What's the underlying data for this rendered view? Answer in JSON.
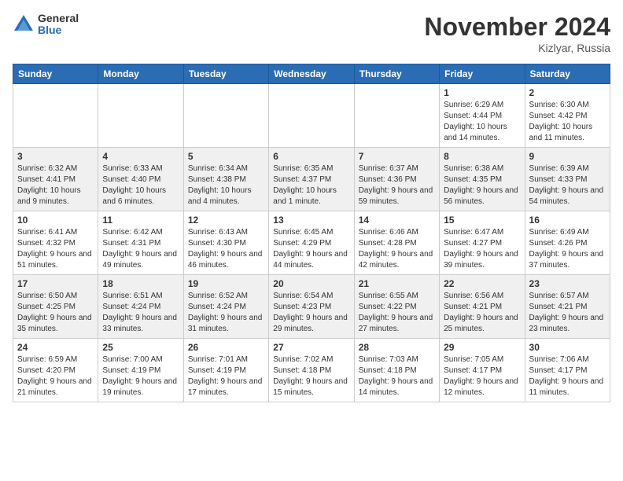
{
  "logo": {
    "general": "General",
    "blue": "Blue"
  },
  "title": "November 2024",
  "location": "Kizlyar, Russia",
  "days_of_week": [
    "Sunday",
    "Monday",
    "Tuesday",
    "Wednesday",
    "Thursday",
    "Friday",
    "Saturday"
  ],
  "weeks": [
    [
      {
        "day": "",
        "info": ""
      },
      {
        "day": "",
        "info": ""
      },
      {
        "day": "",
        "info": ""
      },
      {
        "day": "",
        "info": ""
      },
      {
        "day": "",
        "info": ""
      },
      {
        "day": "1",
        "info": "Sunrise: 6:29 AM\nSunset: 4:44 PM\nDaylight: 10 hours and 14 minutes."
      },
      {
        "day": "2",
        "info": "Sunrise: 6:30 AM\nSunset: 4:42 PM\nDaylight: 10 hours and 11 minutes."
      }
    ],
    [
      {
        "day": "3",
        "info": "Sunrise: 6:32 AM\nSunset: 4:41 PM\nDaylight: 10 hours and 9 minutes."
      },
      {
        "day": "4",
        "info": "Sunrise: 6:33 AM\nSunset: 4:40 PM\nDaylight: 10 hours and 6 minutes."
      },
      {
        "day": "5",
        "info": "Sunrise: 6:34 AM\nSunset: 4:38 PM\nDaylight: 10 hours and 4 minutes."
      },
      {
        "day": "6",
        "info": "Sunrise: 6:35 AM\nSunset: 4:37 PM\nDaylight: 10 hours and 1 minute."
      },
      {
        "day": "7",
        "info": "Sunrise: 6:37 AM\nSunset: 4:36 PM\nDaylight: 9 hours and 59 minutes."
      },
      {
        "day": "8",
        "info": "Sunrise: 6:38 AM\nSunset: 4:35 PM\nDaylight: 9 hours and 56 minutes."
      },
      {
        "day": "9",
        "info": "Sunrise: 6:39 AM\nSunset: 4:33 PM\nDaylight: 9 hours and 54 minutes."
      }
    ],
    [
      {
        "day": "10",
        "info": "Sunrise: 6:41 AM\nSunset: 4:32 PM\nDaylight: 9 hours and 51 minutes."
      },
      {
        "day": "11",
        "info": "Sunrise: 6:42 AM\nSunset: 4:31 PM\nDaylight: 9 hours and 49 minutes."
      },
      {
        "day": "12",
        "info": "Sunrise: 6:43 AM\nSunset: 4:30 PM\nDaylight: 9 hours and 46 minutes."
      },
      {
        "day": "13",
        "info": "Sunrise: 6:45 AM\nSunset: 4:29 PM\nDaylight: 9 hours and 44 minutes."
      },
      {
        "day": "14",
        "info": "Sunrise: 6:46 AM\nSunset: 4:28 PM\nDaylight: 9 hours and 42 minutes."
      },
      {
        "day": "15",
        "info": "Sunrise: 6:47 AM\nSunset: 4:27 PM\nDaylight: 9 hours and 39 minutes."
      },
      {
        "day": "16",
        "info": "Sunrise: 6:49 AM\nSunset: 4:26 PM\nDaylight: 9 hours and 37 minutes."
      }
    ],
    [
      {
        "day": "17",
        "info": "Sunrise: 6:50 AM\nSunset: 4:25 PM\nDaylight: 9 hours and 35 minutes."
      },
      {
        "day": "18",
        "info": "Sunrise: 6:51 AM\nSunset: 4:24 PM\nDaylight: 9 hours and 33 minutes."
      },
      {
        "day": "19",
        "info": "Sunrise: 6:52 AM\nSunset: 4:24 PM\nDaylight: 9 hours and 31 minutes."
      },
      {
        "day": "20",
        "info": "Sunrise: 6:54 AM\nSunset: 4:23 PM\nDaylight: 9 hours and 29 minutes."
      },
      {
        "day": "21",
        "info": "Sunrise: 6:55 AM\nSunset: 4:22 PM\nDaylight: 9 hours and 27 minutes."
      },
      {
        "day": "22",
        "info": "Sunrise: 6:56 AM\nSunset: 4:21 PM\nDaylight: 9 hours and 25 minutes."
      },
      {
        "day": "23",
        "info": "Sunrise: 6:57 AM\nSunset: 4:21 PM\nDaylight: 9 hours and 23 minutes."
      }
    ],
    [
      {
        "day": "24",
        "info": "Sunrise: 6:59 AM\nSunset: 4:20 PM\nDaylight: 9 hours and 21 minutes."
      },
      {
        "day": "25",
        "info": "Sunrise: 7:00 AM\nSunset: 4:19 PM\nDaylight: 9 hours and 19 minutes."
      },
      {
        "day": "26",
        "info": "Sunrise: 7:01 AM\nSunset: 4:19 PM\nDaylight: 9 hours and 17 minutes."
      },
      {
        "day": "27",
        "info": "Sunrise: 7:02 AM\nSunset: 4:18 PM\nDaylight: 9 hours and 15 minutes."
      },
      {
        "day": "28",
        "info": "Sunrise: 7:03 AM\nSunset: 4:18 PM\nDaylight: 9 hours and 14 minutes."
      },
      {
        "day": "29",
        "info": "Sunrise: 7:05 AM\nSunset: 4:17 PM\nDaylight: 9 hours and 12 minutes."
      },
      {
        "day": "30",
        "info": "Sunrise: 7:06 AM\nSunset: 4:17 PM\nDaylight: 9 hours and 11 minutes."
      }
    ]
  ]
}
